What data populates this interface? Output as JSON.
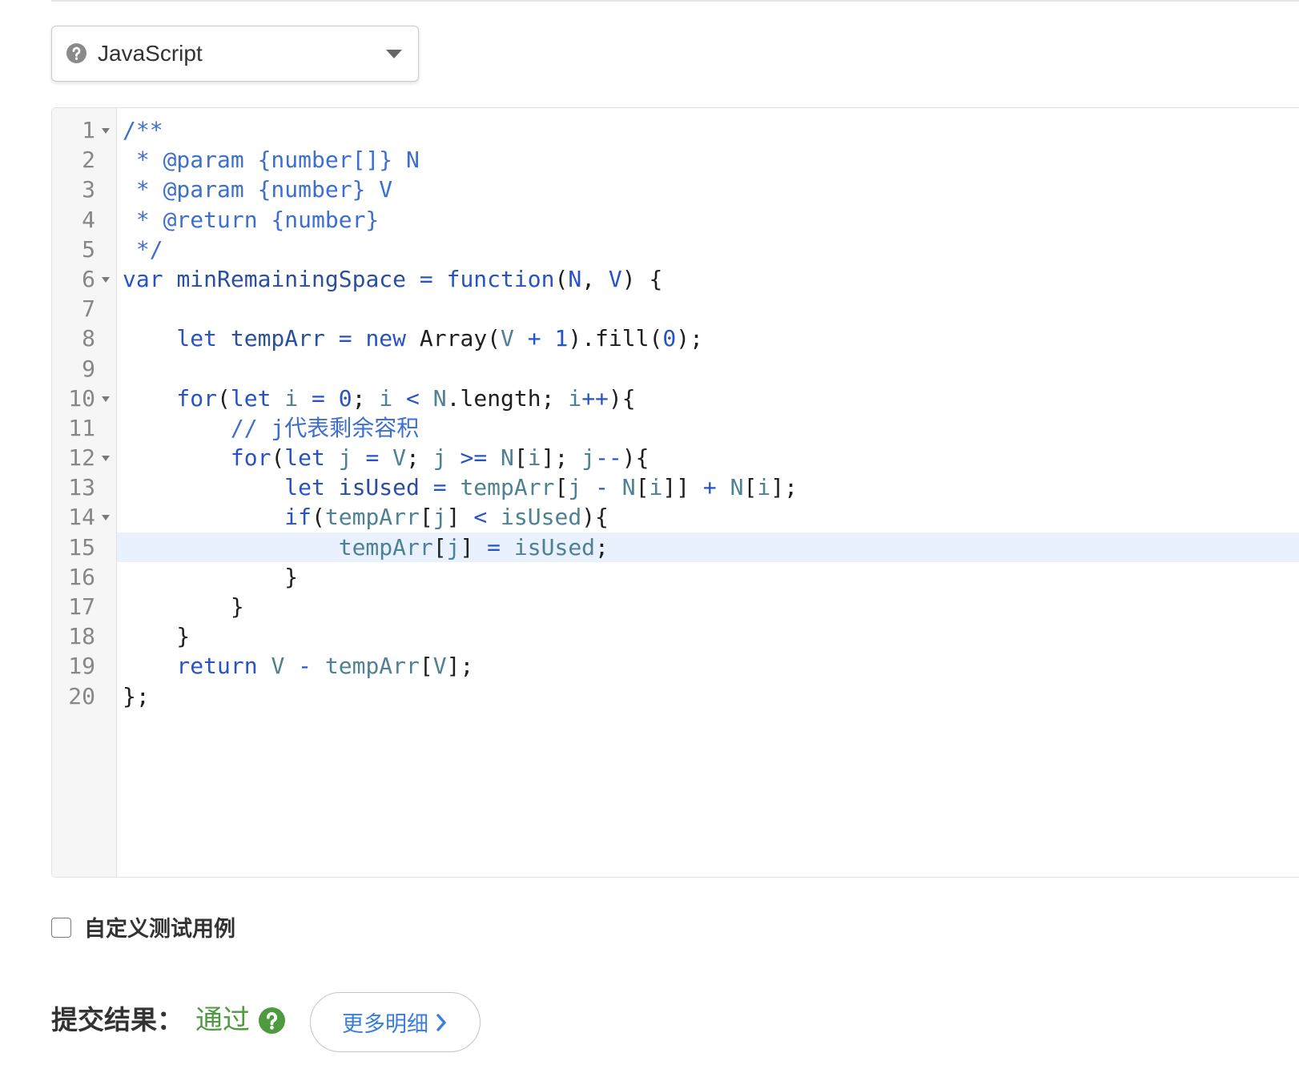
{
  "theme": {
    "accent": "#3b7ddd",
    "success": "#4e9a3f",
    "active_line": "#e8f1fd"
  },
  "language_select": {
    "icon": "question-circle-icon",
    "value": "JavaScript",
    "caret_icon": "caret-down-icon"
  },
  "editor": {
    "active_line": 15,
    "lines": [
      {
        "num": "1",
        "fold": true,
        "tokens": [
          [
            "/**",
            "#3c6fd0"
          ]
        ]
      },
      {
        "num": "2",
        "fold": false,
        "tokens": [
          [
            " * @param {number[]} N",
            "#3c6fd0"
          ]
        ]
      },
      {
        "num": "3",
        "fold": false,
        "tokens": [
          [
            " * @param {number} V",
            "#3c6fd0"
          ]
        ]
      },
      {
        "num": "4",
        "fold": false,
        "tokens": [
          [
            " * @return {number}",
            "#3c6fd0"
          ]
        ]
      },
      {
        "num": "5",
        "fold": false,
        "tokens": [
          [
            " */",
            "#3c6fd0"
          ]
        ]
      },
      {
        "num": "6",
        "fold": true,
        "tokens": [
          [
            "var ",
            "#2753c7"
          ],
          [
            "minRemainingSpace",
            "#2b4f9f"
          ],
          [
            " = function",
            "#2753c7"
          ],
          [
            "(",
            "#1f1f1f"
          ],
          [
            "N",
            "#2753c7"
          ],
          [
            ", ",
            "#1f1f1f"
          ],
          [
            "V",
            "#2753c7"
          ],
          [
            ") {",
            "#1f1f1f"
          ]
        ]
      },
      {
        "num": "7",
        "fold": false,
        "tokens": []
      },
      {
        "num": "8",
        "fold": false,
        "tokens": [
          [
            "    let ",
            "#2753c7"
          ],
          [
            "tempArr",
            "#2b4f9f"
          ],
          [
            " = new ",
            "#2753c7"
          ],
          [
            "Array(",
            "#1f1f1f"
          ],
          [
            "V",
            "#4e8194"
          ],
          [
            " + 1",
            "#2753c7"
          ],
          [
            ").fill(",
            "#1f1f1f"
          ],
          [
            "0",
            "#2753c7"
          ],
          [
            ");",
            "#1f1f1f"
          ]
        ]
      },
      {
        "num": "9",
        "fold": false,
        "tokens": []
      },
      {
        "num": "10",
        "fold": true,
        "tokens": [
          [
            "    for",
            "#2753c7"
          ],
          [
            "(",
            "#1f1f1f"
          ],
          [
            "let ",
            "#2753c7"
          ],
          [
            "i",
            "#4e8194"
          ],
          [
            " = 0",
            "#2753c7"
          ],
          [
            "; ",
            "#1f1f1f"
          ],
          [
            "i",
            "#4e8194"
          ],
          [
            " < ",
            "#2753c7"
          ],
          [
            "N",
            "#4e8194"
          ],
          [
            ".length; ",
            "#1f1f1f"
          ],
          [
            "i",
            "#4e8194"
          ],
          [
            "++",
            "#2753c7"
          ],
          [
            "){",
            "#1f1f1f"
          ]
        ]
      },
      {
        "num": "11",
        "fold": false,
        "tokens": [
          [
            "        // j代表剩余容积",
            "#3c6fd0"
          ]
        ]
      },
      {
        "num": "12",
        "fold": true,
        "tokens": [
          [
            "        for",
            "#2753c7"
          ],
          [
            "(",
            "#1f1f1f"
          ],
          [
            "let ",
            "#2753c7"
          ],
          [
            "j",
            "#4e8194"
          ],
          [
            " = ",
            "#2753c7"
          ],
          [
            "V",
            "#4e8194"
          ],
          [
            "; ",
            "#1f1f1f"
          ],
          [
            "j",
            "#4e8194"
          ],
          [
            " >= ",
            "#2753c7"
          ],
          [
            "N",
            "#4e8194"
          ],
          [
            "[",
            "#1f1f1f"
          ],
          [
            "i",
            "#4e8194"
          ],
          [
            "]; ",
            "#1f1f1f"
          ],
          [
            "j",
            "#4e8194"
          ],
          [
            "--",
            "#2753c7"
          ],
          [
            "){",
            "#1f1f1f"
          ]
        ]
      },
      {
        "num": "13",
        "fold": false,
        "tokens": [
          [
            "            let ",
            "#2753c7"
          ],
          [
            "isUsed",
            "#2b4f9f"
          ],
          [
            " = ",
            "#2753c7"
          ],
          [
            "tempArr",
            "#4e8194"
          ],
          [
            "[",
            "#1f1f1f"
          ],
          [
            "j",
            "#4e8194"
          ],
          [
            " - ",
            "#2753c7"
          ],
          [
            "N",
            "#4e8194"
          ],
          [
            "[",
            "#1f1f1f"
          ],
          [
            "i",
            "#4e8194"
          ],
          [
            "]]",
            "#1f1f1f"
          ],
          [
            " + ",
            "#2753c7"
          ],
          [
            "N",
            "#4e8194"
          ],
          [
            "[",
            "#1f1f1f"
          ],
          [
            "i",
            "#4e8194"
          ],
          [
            "];",
            "#1f1f1f"
          ]
        ]
      },
      {
        "num": "14",
        "fold": true,
        "tokens": [
          [
            "            if",
            "#2753c7"
          ],
          [
            "(",
            "#1f1f1f"
          ],
          [
            "tempArr",
            "#4e8194"
          ],
          [
            "[",
            "#1f1f1f"
          ],
          [
            "j",
            "#4e8194"
          ],
          [
            "] ",
            "#1f1f1f"
          ],
          [
            "< ",
            "#2753c7"
          ],
          [
            "isUsed",
            "#4e8194"
          ],
          [
            "){",
            "#1f1f1f"
          ]
        ]
      },
      {
        "num": "15",
        "fold": false,
        "tokens": [
          [
            "                tempArr",
            "#4e8194"
          ],
          [
            "[",
            "#1f1f1f"
          ],
          [
            "j",
            "#4e8194"
          ],
          [
            "] ",
            "#1f1f1f"
          ],
          [
            "= ",
            "#2753c7"
          ],
          [
            "isUsed",
            "#4e8194"
          ],
          [
            ";",
            "#1f1f1f"
          ]
        ]
      },
      {
        "num": "16",
        "fold": false,
        "tokens": [
          [
            "            }",
            "#1f1f1f"
          ]
        ]
      },
      {
        "num": "17",
        "fold": false,
        "tokens": [
          [
            "        }",
            "#1f1f1f"
          ]
        ]
      },
      {
        "num": "18",
        "fold": false,
        "tokens": [
          [
            "    }",
            "#1f1f1f"
          ]
        ]
      },
      {
        "num": "19",
        "fold": false,
        "tokens": [
          [
            "    return ",
            "#2753c7"
          ],
          [
            "V",
            "#4e8194"
          ],
          [
            " - ",
            "#2753c7"
          ],
          [
            "tempArr",
            "#4e8194"
          ],
          [
            "[",
            "#1f1f1f"
          ],
          [
            "V",
            "#4e8194"
          ],
          [
            "];",
            "#1f1f1f"
          ]
        ]
      },
      {
        "num": "20",
        "fold": false,
        "tokens": [
          [
            "};",
            "#1f1f1f"
          ]
        ]
      }
    ]
  },
  "custom_test": {
    "checked": false,
    "label": "自定义测试用例"
  },
  "result": {
    "label": "提交结果：",
    "status": "通过",
    "status_color": "#4e9a3f",
    "help_icon": "question-circle-icon",
    "details_button": "更多明细",
    "details_icon": "chevron-right-icon"
  }
}
